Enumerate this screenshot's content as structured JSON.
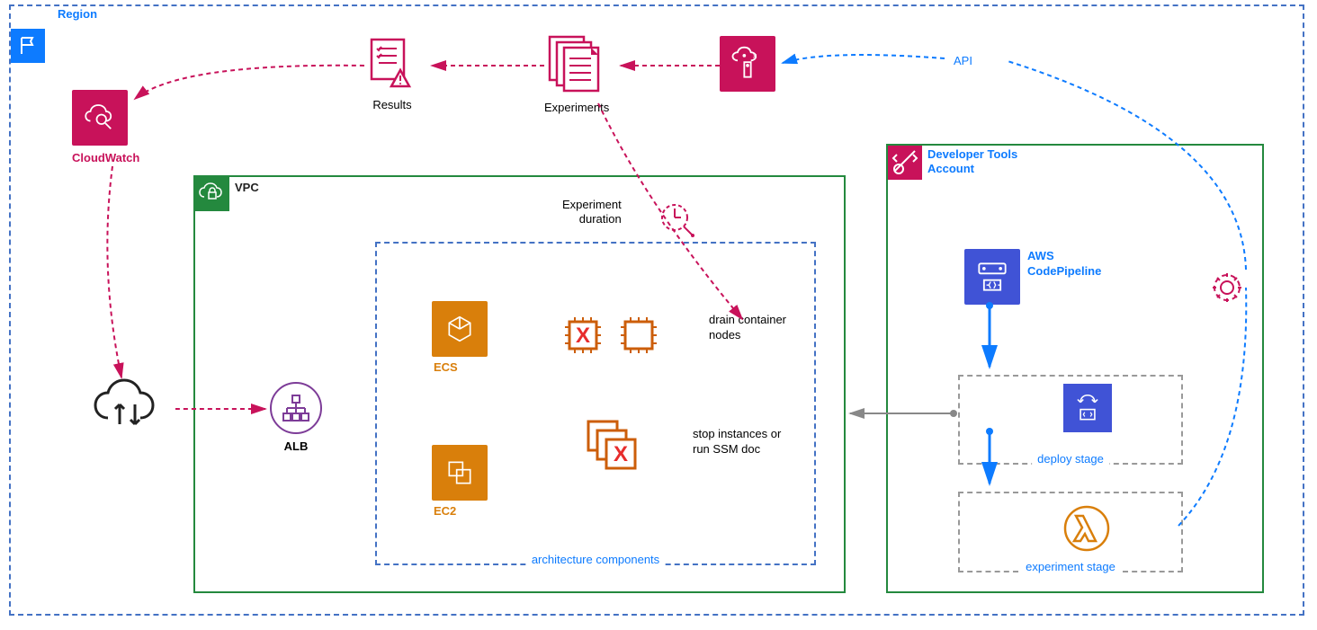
{
  "region": {
    "label": "Region"
  },
  "cloudwatch": {
    "label": "CloudWatch"
  },
  "vpc": {
    "label": "VPC"
  },
  "arch": {
    "label": "architecture components"
  },
  "ecs": {
    "label": "ECS"
  },
  "ec2": {
    "label": "EC2"
  },
  "alb": {
    "label": "ALB"
  },
  "drain": {
    "label": "drain container nodes"
  },
  "stop": {
    "label": "stop instances or run SSM doc"
  },
  "experiment_duration": {
    "label": "Experiment duration"
  },
  "results": {
    "label": "Results"
  },
  "experiments": {
    "label": "Experiments"
  },
  "devtools": {
    "label": "Developer Tools Account"
  },
  "codepipeline": {
    "label": "AWS CodePipeline"
  },
  "deploy_stage": {
    "label": "deploy stage"
  },
  "experiment_stage": {
    "label": "experiment stage"
  },
  "api": {
    "label": "API"
  }
}
